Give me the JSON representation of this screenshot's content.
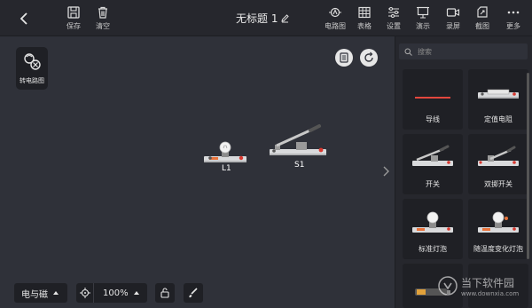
{
  "topbar": {
    "left_buttons": [
      {
        "label": "保存",
        "icon": "save-icon"
      },
      {
        "label": "清空",
        "icon": "trash-icon"
      }
    ],
    "title": "无标题 1",
    "right_buttons": [
      {
        "label": "电路图",
        "icon": "circuit-diagram-icon"
      },
      {
        "label": "表格",
        "icon": "table-icon"
      },
      {
        "label": "设置",
        "icon": "settings-sliders-icon"
      },
      {
        "label": "演示",
        "icon": "presentation-icon"
      },
      {
        "label": "录屏",
        "icon": "record-screen-icon"
      },
      {
        "label": "截图",
        "icon": "screenshot-icon"
      },
      {
        "label": "更多",
        "icon": "more-dots-icon"
      }
    ]
  },
  "canvas": {
    "switch_mode_label": "转电路图",
    "components": [
      {
        "label": "L1",
        "type": "bulb"
      },
      {
        "label": "S1",
        "type": "switch"
      }
    ]
  },
  "bottom_bar": {
    "category": "电与磁",
    "zoom": "100%"
  },
  "panel": {
    "search_placeholder": "搜索",
    "items": [
      {
        "label": "导线",
        "icon": "wire-icon"
      },
      {
        "label": "定值电阻",
        "icon": "resistor-icon"
      },
      {
        "label": "开关",
        "icon": "switch-icon"
      },
      {
        "label": "双掷开关",
        "icon": "double-throw-switch-icon"
      },
      {
        "label": "标准灯泡",
        "icon": "bulb-icon"
      },
      {
        "label": "随温度变化灯泡",
        "icon": "temp-bulb-icon"
      }
    ]
  },
  "watermark": {
    "text": "当下软件园",
    "url": "www.downxia.com"
  },
  "colors": {
    "topbar": "#26272d",
    "canvas": "#2f3139",
    "panel": "#26272d",
    "card": "#1f2025",
    "wire": "#e4473d",
    "switch_red": "#d8372e"
  }
}
